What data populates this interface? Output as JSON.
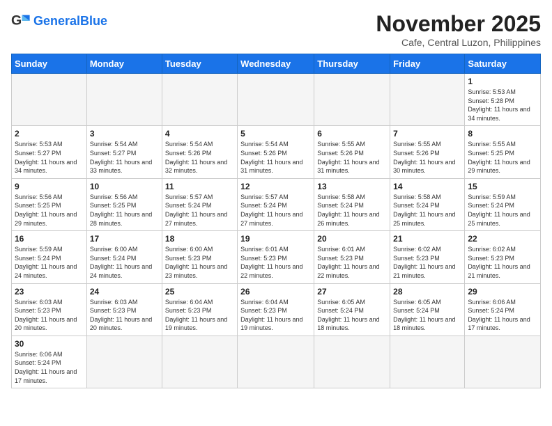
{
  "logo": {
    "general": "General",
    "blue": "Blue"
  },
  "header": {
    "title": "November 2025",
    "subtitle": "Cafe, Central Luzon, Philippines"
  },
  "days_of_week": [
    "Sunday",
    "Monday",
    "Tuesday",
    "Wednesday",
    "Thursday",
    "Friday",
    "Saturday"
  ],
  "weeks": [
    [
      {
        "day": null
      },
      {
        "day": null
      },
      {
        "day": null
      },
      {
        "day": null
      },
      {
        "day": null
      },
      {
        "day": null
      },
      {
        "day": 1,
        "sunrise": "5:53 AM",
        "sunset": "5:28 PM",
        "daylight": "11 hours and 34 minutes."
      }
    ],
    [
      {
        "day": 2,
        "sunrise": "5:53 AM",
        "sunset": "5:27 PM",
        "daylight": "11 hours and 34 minutes."
      },
      {
        "day": 3,
        "sunrise": "5:54 AM",
        "sunset": "5:27 PM",
        "daylight": "11 hours and 33 minutes."
      },
      {
        "day": 4,
        "sunrise": "5:54 AM",
        "sunset": "5:26 PM",
        "daylight": "11 hours and 32 minutes."
      },
      {
        "day": 5,
        "sunrise": "5:54 AM",
        "sunset": "5:26 PM",
        "daylight": "11 hours and 31 minutes."
      },
      {
        "day": 6,
        "sunrise": "5:55 AM",
        "sunset": "5:26 PM",
        "daylight": "11 hours and 31 minutes."
      },
      {
        "day": 7,
        "sunrise": "5:55 AM",
        "sunset": "5:26 PM",
        "daylight": "11 hours and 30 minutes."
      },
      {
        "day": 8,
        "sunrise": "5:55 AM",
        "sunset": "5:25 PM",
        "daylight": "11 hours and 29 minutes."
      }
    ],
    [
      {
        "day": 9,
        "sunrise": "5:56 AM",
        "sunset": "5:25 PM",
        "daylight": "11 hours and 29 minutes."
      },
      {
        "day": 10,
        "sunrise": "5:56 AM",
        "sunset": "5:25 PM",
        "daylight": "11 hours and 28 minutes."
      },
      {
        "day": 11,
        "sunrise": "5:57 AM",
        "sunset": "5:24 PM",
        "daylight": "11 hours and 27 minutes."
      },
      {
        "day": 12,
        "sunrise": "5:57 AM",
        "sunset": "5:24 PM",
        "daylight": "11 hours and 27 minutes."
      },
      {
        "day": 13,
        "sunrise": "5:58 AM",
        "sunset": "5:24 PM",
        "daylight": "11 hours and 26 minutes."
      },
      {
        "day": 14,
        "sunrise": "5:58 AM",
        "sunset": "5:24 PM",
        "daylight": "11 hours and 25 minutes."
      },
      {
        "day": 15,
        "sunrise": "5:59 AM",
        "sunset": "5:24 PM",
        "daylight": "11 hours and 25 minutes."
      }
    ],
    [
      {
        "day": 16,
        "sunrise": "5:59 AM",
        "sunset": "5:24 PM",
        "daylight": "11 hours and 24 minutes."
      },
      {
        "day": 17,
        "sunrise": "6:00 AM",
        "sunset": "5:24 PM",
        "daylight": "11 hours and 24 minutes."
      },
      {
        "day": 18,
        "sunrise": "6:00 AM",
        "sunset": "5:23 PM",
        "daylight": "11 hours and 23 minutes."
      },
      {
        "day": 19,
        "sunrise": "6:01 AM",
        "sunset": "5:23 PM",
        "daylight": "11 hours and 22 minutes."
      },
      {
        "day": 20,
        "sunrise": "6:01 AM",
        "sunset": "5:23 PM",
        "daylight": "11 hours and 22 minutes."
      },
      {
        "day": 21,
        "sunrise": "6:02 AM",
        "sunset": "5:23 PM",
        "daylight": "11 hours and 21 minutes."
      },
      {
        "day": 22,
        "sunrise": "6:02 AM",
        "sunset": "5:23 PM",
        "daylight": "11 hours and 21 minutes."
      }
    ],
    [
      {
        "day": 23,
        "sunrise": "6:03 AM",
        "sunset": "5:23 PM",
        "daylight": "11 hours and 20 minutes."
      },
      {
        "day": 24,
        "sunrise": "6:03 AM",
        "sunset": "5:23 PM",
        "daylight": "11 hours and 20 minutes."
      },
      {
        "day": 25,
        "sunrise": "6:04 AM",
        "sunset": "5:23 PM",
        "daylight": "11 hours and 19 minutes."
      },
      {
        "day": 26,
        "sunrise": "6:04 AM",
        "sunset": "5:23 PM",
        "daylight": "11 hours and 19 minutes."
      },
      {
        "day": 27,
        "sunrise": "6:05 AM",
        "sunset": "5:24 PM",
        "daylight": "11 hours and 18 minutes."
      },
      {
        "day": 28,
        "sunrise": "6:05 AM",
        "sunset": "5:24 PM",
        "daylight": "11 hours and 18 minutes."
      },
      {
        "day": 29,
        "sunrise": "6:06 AM",
        "sunset": "5:24 PM",
        "daylight": "11 hours and 17 minutes."
      }
    ],
    [
      {
        "day": 30,
        "sunrise": "6:06 AM",
        "sunset": "5:24 PM",
        "daylight": "11 hours and 17 minutes."
      },
      {
        "day": null
      },
      {
        "day": null
      },
      {
        "day": null
      },
      {
        "day": null
      },
      {
        "day": null
      },
      {
        "day": null
      }
    ]
  ]
}
